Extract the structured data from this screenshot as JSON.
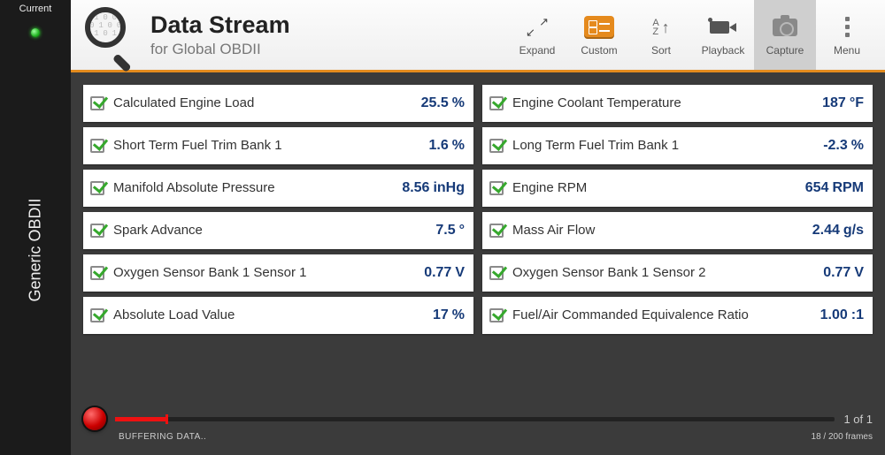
{
  "rail": {
    "tab_label": "Current",
    "title": "Generic OBDII"
  },
  "header": {
    "title": "Data Stream",
    "subtitle": "for Global OBDII",
    "mag_bits": "0 1 0 0 1\n1 0 1 0 0 1\n0 1 0 1 0",
    "toolbar": {
      "expand": "Expand",
      "custom": "Custom",
      "sort": "Sort",
      "sort_az_top": "A",
      "sort_az_bot": "Z",
      "playback": "Playback",
      "capture": "Capture",
      "menu": "Menu"
    }
  },
  "pids": [
    {
      "label": "Calculated Engine Load",
      "value": "25.5",
      "unit": "%"
    },
    {
      "label": "Engine Coolant Temperature",
      "value": "187",
      "unit": "°F"
    },
    {
      "label": "Short Term Fuel Trim Bank 1",
      "value": "1.6",
      "unit": "%"
    },
    {
      "label": "Long Term Fuel Trim Bank 1",
      "value": "-2.3",
      "unit": "%"
    },
    {
      "label": "Manifold Absolute Pressure",
      "value": "8.56",
      "unit": "inHg"
    },
    {
      "label": "Engine RPM",
      "value": "654",
      "unit": "RPM"
    },
    {
      "label": "Spark Advance",
      "value": "7.5",
      "unit": "°"
    },
    {
      "label": "Mass Air Flow",
      "value": "2.44",
      "unit": "g/s"
    },
    {
      "label": "Oxygen Sensor Bank 1 Sensor 1",
      "value": "0.77",
      "unit": "V"
    },
    {
      "label": "Oxygen Sensor Bank 1 Sensor 2",
      "value": "0.77",
      "unit": "V"
    },
    {
      "label": "Absolute Load Value",
      "value": "17",
      "unit": "%"
    },
    {
      "label": "Fuel/Air Commanded Equivalence Ratio",
      "value": "1.00",
      "unit": ":1"
    }
  ],
  "footer": {
    "page": "1 of 1",
    "buffering": "BUFFERING DATA..",
    "frames": "18 / 200 frames"
  }
}
